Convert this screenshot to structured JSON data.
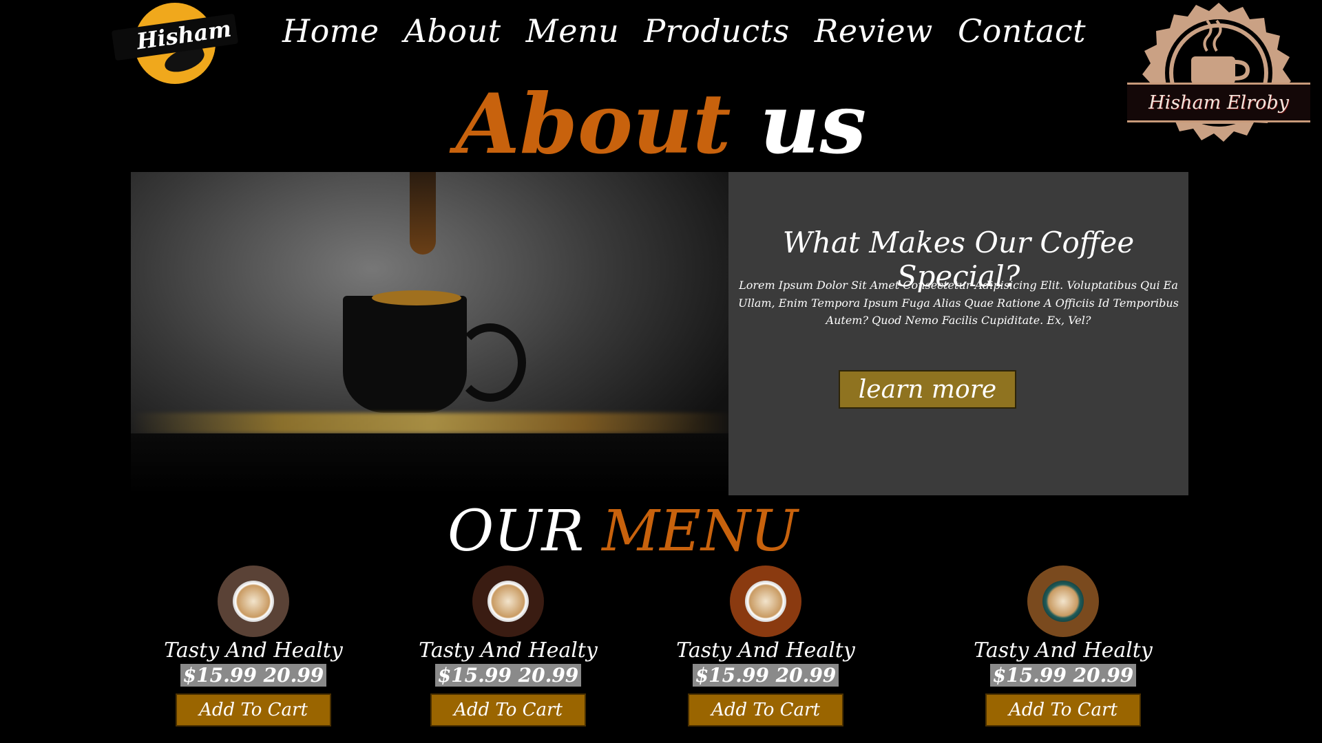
{
  "header": {
    "logo_text": "Hisham",
    "nav": [
      "Home",
      "About",
      "Menu",
      "Products",
      "Review",
      "Contact"
    ],
    "badge_text": "Hisham Elroby"
  },
  "about": {
    "title_accent": "About",
    "title_rest": "us",
    "heading": "What Makes Our Coffee Special?",
    "body": "Lorem Ipsum Dolor Sit Amet Consectetur Adipisicing Elit. Voluptatibus Qui Ea Ullam, Enim Tempora Ipsum Fuga Alias Quae Ratione A Officiis Id Temporibus Autem? Quod Nemo Facilis Cupiditate. Ex, Vel?",
    "button": "learn more"
  },
  "menu": {
    "title_white": "OUR",
    "title_accent": "MENU",
    "items": [
      {
        "name": "Tasty And Healty",
        "price": "$15.99 20.99",
        "button": "Add To Cart"
      },
      {
        "name": "Tasty And Healty",
        "price": "$15.99 20.99",
        "button": "Add To Cart"
      },
      {
        "name": "Tasty And Healty",
        "price": "$15.99 20.99",
        "button": "Add To Cart"
      },
      {
        "name": "Tasty And Healty",
        "price": "$15.99 20.99",
        "button": "Add To Cart"
      }
    ]
  },
  "colors": {
    "accent": "#c8620d",
    "button_gold": "#8f7320",
    "cart_button": "#9a6500",
    "panel": "#3b3b3b",
    "logo_yellow": "#f0a81c"
  }
}
